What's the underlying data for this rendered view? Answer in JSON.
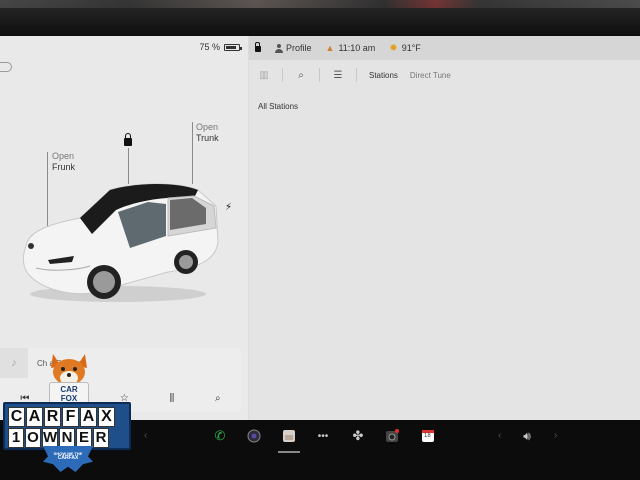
{
  "car": {
    "battery": "75 %",
    "frunk": {
      "line1": "Open",
      "line2": "Frunk"
    },
    "trunk": {
      "line1": "Open",
      "line2": "Trunk"
    }
  },
  "status_bar": {
    "profile": "Profile",
    "time": "11:10 am",
    "temperature": "91°F"
  },
  "radio": {
    "tabs": [
      "Stations",
      "Direct Tune"
    ],
    "active_tab": "Stations",
    "section_label": "All Stations"
  },
  "media": {
    "source_text": "Ch        a Source"
  },
  "dock": {
    "calendar_day": "18",
    "icons": [
      "phone-icon",
      "camera-icon",
      "toybox-icon",
      "more-icon",
      "fan-icon",
      "dashcam-icon",
      "calendar-icon",
      "volume-icon"
    ]
  },
  "carfax": {
    "sign": [
      "CAR",
      "FOX"
    ],
    "row1": [
      "C",
      "A",
      "R",
      "F",
      "A",
      "X"
    ],
    "row2": [
      "1",
      "O",
      "W",
      "N",
      "E",
      "R"
    ],
    "tagline": [
      "SHOW ME THE",
      "CARFAX"
    ]
  },
  "colors": {
    "screen_bg": "#e4e4e4",
    "car_panel_bg": "#e9e9e9",
    "dock_bg": "#0c0c0c",
    "phone_green": "#27b34a",
    "carfax_blue": "#1e4f8a"
  }
}
